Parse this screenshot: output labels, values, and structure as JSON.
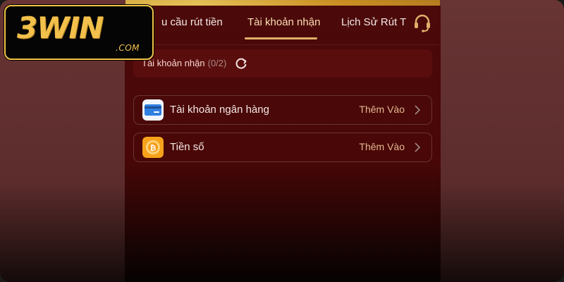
{
  "logo": {
    "brand": "3WIN",
    "domain_suffix": ".COM"
  },
  "tabs": [
    {
      "label": "u cầu rút tiền",
      "active": false
    },
    {
      "label": "Tài khoản nhận",
      "active": true
    },
    {
      "label": "Lịch Sử Rút T",
      "active": false
    }
  ],
  "accounts": {
    "title": "Tài khoản nhận",
    "count": "(0/2)"
  },
  "rows": [
    {
      "label": "Tài khoản ngân hàng",
      "action": "Thêm Vào",
      "icon": "bank-card-icon"
    },
    {
      "label": "Tiền số",
      "action": "Thêm Vào",
      "icon": "crypto-coin-icon"
    }
  ],
  "colors": {
    "accent": "#e0b06a",
    "background": "#4a0707",
    "logo_gold": "#f2c04b"
  }
}
